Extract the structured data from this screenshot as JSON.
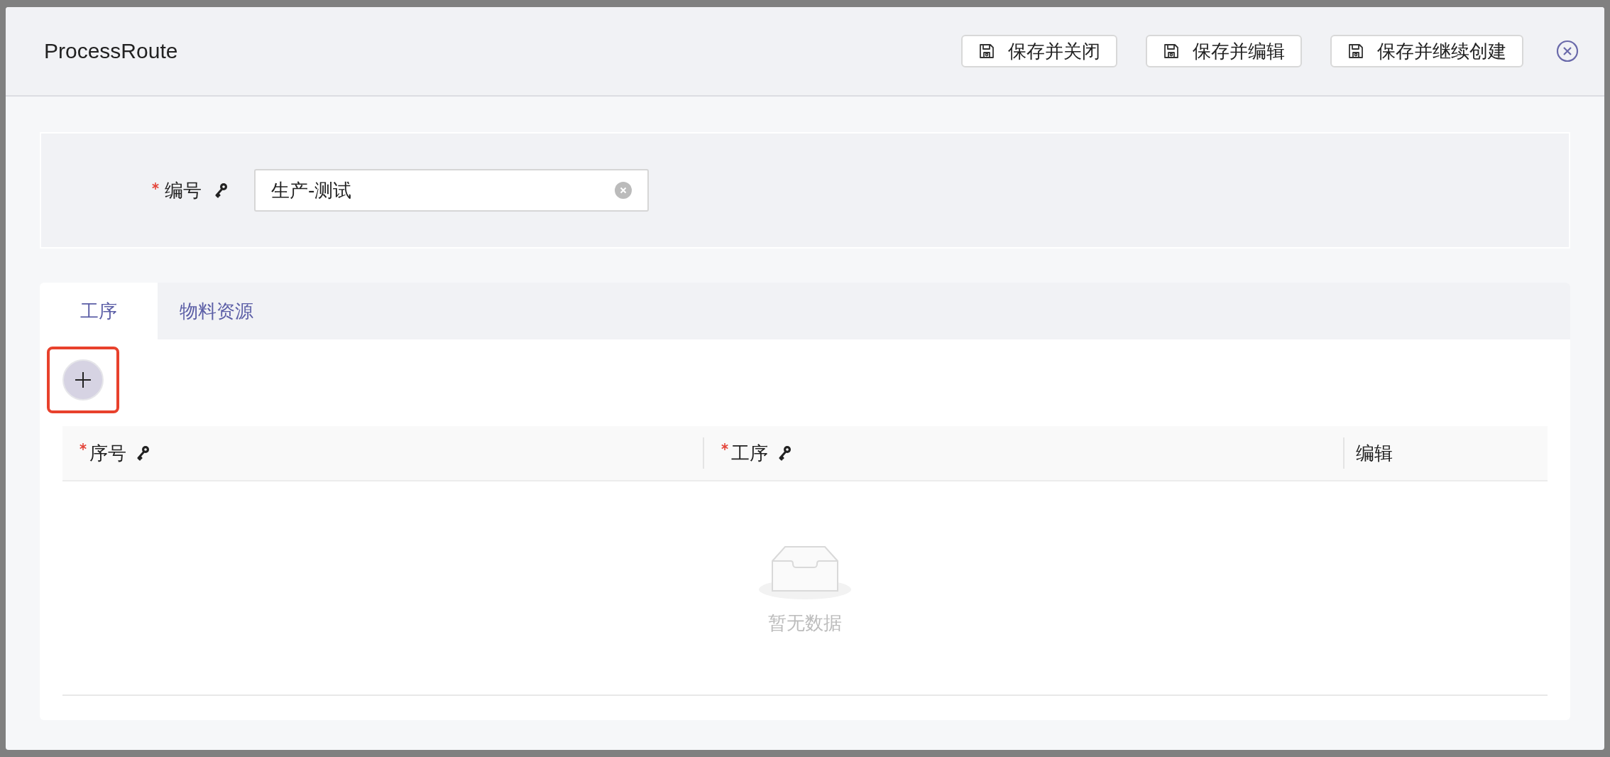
{
  "window": {
    "title": "ProcessRoute"
  },
  "header_buttons": [
    {
      "label": "保存并关闭"
    },
    {
      "label": "保存并编辑"
    },
    {
      "label": "保存并继续创建"
    }
  ],
  "form": {
    "fields": [
      {
        "label": "编号",
        "required": true,
        "key": true,
        "value": "生产-测试"
      }
    ]
  },
  "tabs": [
    {
      "label": "工序",
      "selected": true
    },
    {
      "label": "物料资源",
      "selected": false
    }
  ],
  "table": {
    "columns": [
      {
        "label": "序号",
        "required": true,
        "key": true
      },
      {
        "label": "工序",
        "required": true,
        "key": true
      },
      {
        "label": "编辑",
        "required": false,
        "key": false
      }
    ],
    "empty_text": "暂无数据"
  },
  "add_button": {
    "highlighted": true
  }
}
